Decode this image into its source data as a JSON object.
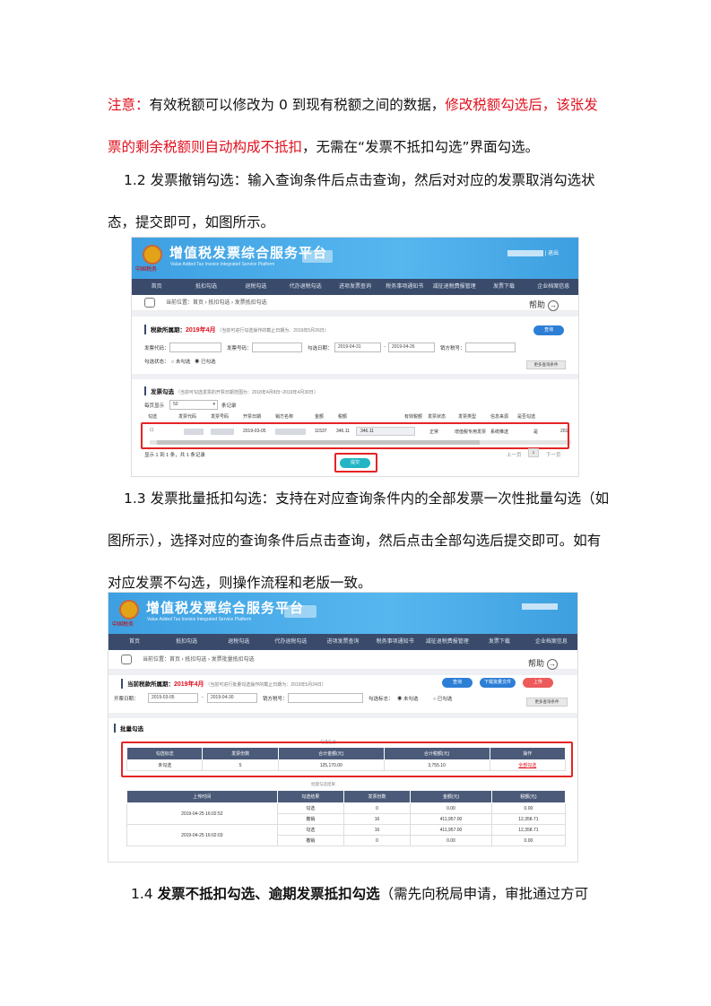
{
  "paragraphs": {
    "p1": {
      "a": "注意：",
      "b": "有效税额可以修改为 0 到现有税额之间的数据，",
      "c": "修改税额勾选后，该张发票的剩余税额则自动构成不抵扣",
      "d": "，无需在“发票不抵扣勾选”界面勾选。"
    },
    "p2": "1.2 发票撤销勾选：输入查询条件后点击查询，然后对对应的发票取消勾选状态，提交即可，如图所示。",
    "p3": "1.3 发票批量抵扣勾选：支持在对应查询条件内的全部发票一次性批量勾选（如图所示），选择对应的查询条件后点击查询，然后点击全部勾选后提交即可。如有对应发票不勾选，则操作流程和老版一致。",
    "p4": {
      "a": "1.4 ",
      "b": "发票不抵扣勾选、逾期发票抵扣勾选",
      "c": "（需先向税局申请，审批通过方可"
    }
  },
  "portal": {
    "title": "增值税发票综合服务平台",
    "subtitle": "Value Added Tax Invoice Integrated Service Platform",
    "logo_text": "中国税务",
    "user_suffix": "退出",
    "help": "帮助",
    "nav": [
      "首页",
      "抵扣勾选",
      "退税勾选",
      "代办退税勾选",
      "进项发票查询",
      "税务事项通知书",
      "减征退税费报管理",
      "发票下载",
      "企业档案信息"
    ],
    "nav2": [
      "首页",
      "抵扣勾选",
      "退税勾选",
      "代办退税勾选",
      "进项发票查询",
      "税务事项通知书",
      "减征退税费报管理",
      "发票下载",
      "企业档案信息"
    ]
  },
  "shot1": {
    "crumb": "当前位置：首页 › 抵扣勾选 › 发票抵扣勾选",
    "period_label": "税款所属期：",
    "period": "2019年4月",
    "period_note": "（当前可进行勾选操作的截止日期为：2019年5月26日）",
    "query": "查询",
    "f_code": "发票代码：",
    "f_num": "发票号码：",
    "f_date": "勾选日期：",
    "date_from": "2019-04-31",
    "date_to": "2019-04-26",
    "f_tax": "销方税号：",
    "status_label": "勾选状态：",
    "opt_no": "未勾选",
    "opt_yes": "已勾选",
    "more": "更多查询条件",
    "list_label": "发票勾选",
    "list_note": "（当前可勾选发票的开票日期范围为：2018年4月8日~2019年4月30日）",
    "page_size_label": "每页显示",
    "page_size": "50",
    "page_size_unit": "条记录",
    "headers": [
      "勾选",
      "发票代码",
      "发票号码",
      "开票日期",
      "销方名称",
      "金额",
      "税额",
      "有效税额",
      "发票状态",
      "发票类型",
      "信息来源",
      "是否勾选"
    ],
    "row": {
      "date": "2019-03-05",
      "amount": "11537",
      "tax": "346.11",
      "valid_tax": "346.11",
      "status": "正常",
      "type": "增值税专用发票",
      "source": "系统推送",
      "checked": "是",
      "cut": "201"
    },
    "footer": "显示 1 到 1 条，共 1 条记录",
    "prev": "上一页",
    "page": "1",
    "next": "下一页",
    "submit": "提交"
  },
  "shot2": {
    "crumb": "当前位置：首页 › 抵扣勾选 › 发票批量抵扣勾选",
    "period_label": "当前税款所属期：",
    "period": "2019年4月",
    "period_note": "（当前可进行批量勾选操作的截止日期为：2019年5月24日）",
    "query": "查询",
    "download": "下载批量文件",
    "upload": "上传",
    "f_date": "开票日期：",
    "date_from": "2019-03-05",
    "date_to": "2019-04-30",
    "f_tax": "销方税号：",
    "flag_label": "勾选标志：",
    "opt_no": "未勾选",
    "opt_yes": "已勾选",
    "more": "更多查询条件",
    "batch_label": "批量勾选",
    "stat_caption": "勾选汇总",
    "stat_headers": [
      "勾选标志",
      "发票份数",
      "合计金额(元)",
      "合计税额(元)",
      "操作"
    ],
    "stat_row": [
      "未勾选",
      "5",
      "125,170.00",
      "3,755.10",
      "全部勾选"
    ],
    "result_caption": "批量勾选结果",
    "result_headers": [
      "上传时间",
      "勾选结果",
      "发票份数",
      "金额(元)",
      "税额(元)"
    ],
    "result_rows": [
      {
        "time": "2019-04-25 16:02:52",
        "r1": [
          "勾选",
          "0",
          "0.00",
          "0.00"
        ],
        "r2": [
          "撤销",
          "16",
          "411,957.00",
          "12,358.71"
        ]
      },
      {
        "time": "2019-04-25 16:02:03",
        "r1": [
          "勾选",
          "16",
          "411,957.00",
          "12,358.71"
        ],
        "r2": [
          "撤销",
          "0",
          "0.00",
          "0.00"
        ]
      }
    ]
  },
  "colors": {
    "red": "#e0101e",
    "nav": "#3a4a6a",
    "banner": "#4aaee9"
  }
}
